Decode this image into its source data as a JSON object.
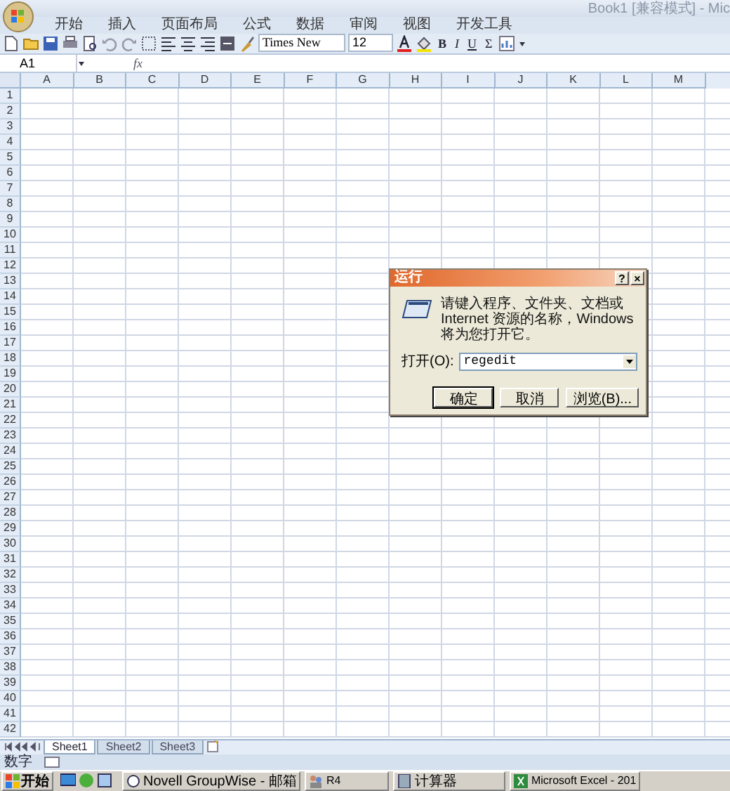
{
  "window": {
    "title": "Book1 [兼容模式] - Mic"
  },
  "ribbon_tabs": [
    "开始",
    "插入",
    "页面布局",
    "公式",
    "数据",
    "审阅",
    "视图",
    "开发工具"
  ],
  "toolbar": {
    "font": "Times New",
    "size": "12",
    "format_buttons": [
      {
        "kind": "bold",
        "label": "B"
      },
      {
        "kind": "italic",
        "label": "I"
      },
      {
        "kind": "underline",
        "label": "U"
      },
      {
        "kind": "sum",
        "label": "Σ"
      }
    ]
  },
  "formula_bar": {
    "name_box": "A1",
    "fx_label": "fx"
  },
  "grid": {
    "columns": [
      "A",
      "B",
      "C",
      "D",
      "E",
      "F",
      "G",
      "H",
      "I",
      "J",
      "K",
      "L",
      "M"
    ],
    "rows": [
      "1",
      "2",
      "3",
      "4",
      "5",
      "6",
      "7",
      "8",
      "9",
      "10",
      "11",
      "12",
      "13",
      "14",
      "15",
      "16",
      "17",
      "18",
      "19",
      "20",
      "21",
      "22",
      "23",
      "24",
      "25",
      "26",
      "27",
      "28",
      "29",
      "30",
      "31",
      "32",
      "33",
      "34",
      "35",
      "36",
      "37",
      "38",
      "39",
      "40",
      "41",
      "42"
    ]
  },
  "sheet_tabs": [
    {
      "label": "Sheet1",
      "selected": true
    },
    {
      "label": "Sheet2",
      "selected": false
    },
    {
      "label": "Sheet3",
      "selected": false
    }
  ],
  "status_bar": {
    "mode": "数字"
  },
  "taskbar": {
    "start": "开始",
    "items": [
      {
        "label": "Novell GroupWise - 邮箱",
        "kind": "mail"
      },
      {
        "label": "R4",
        "kind": "people"
      },
      {
        "label": "计算器",
        "kind": "calculator"
      },
      {
        "label": "Microsoft Excel - 201",
        "kind": "excel"
      }
    ]
  },
  "run_dialog": {
    "title": "运行",
    "help": "?",
    "close": "×",
    "message": "请键入程序、文件夹、文档或 Internet 资源的名称，Windows 将为您打开它。",
    "open_label": "打开(O):",
    "value": "regedit",
    "buttons": [
      "确定",
      "取消",
      "浏览(B)..."
    ]
  }
}
